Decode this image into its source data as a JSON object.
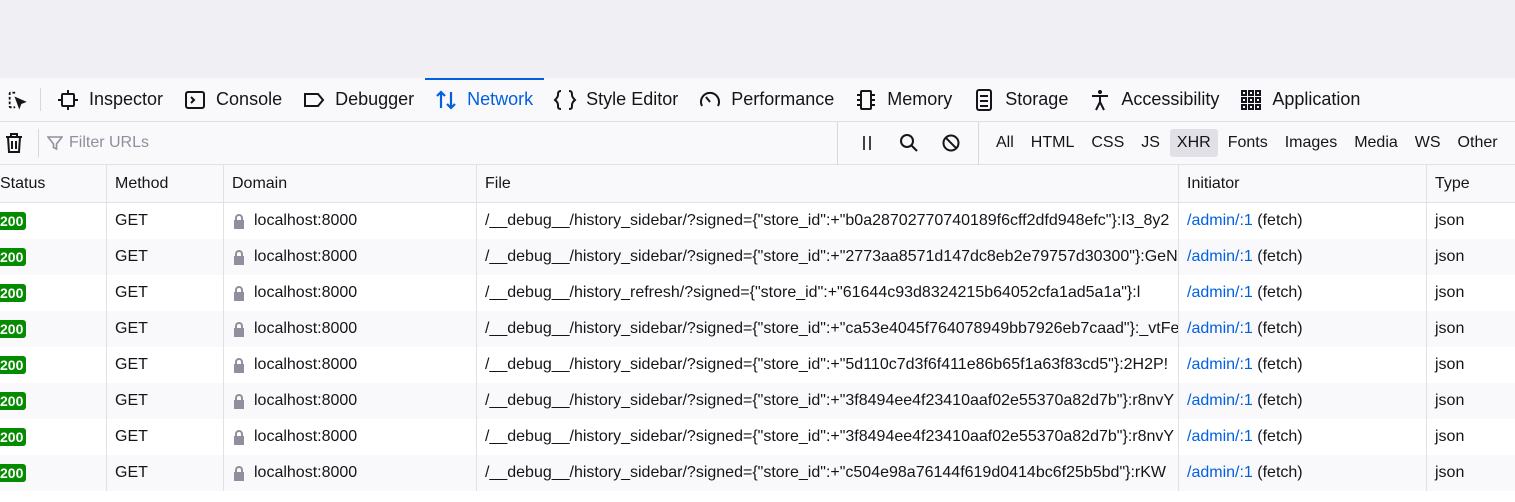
{
  "tabs": [
    {
      "label": "Inspector",
      "icon": "inspector-icon"
    },
    {
      "label": "Console",
      "icon": "console-icon"
    },
    {
      "label": "Debugger",
      "icon": "debugger-icon"
    },
    {
      "label": "Network",
      "icon": "network-icon",
      "active": true
    },
    {
      "label": "Style Editor",
      "icon": "style-editor-icon"
    },
    {
      "label": "Performance",
      "icon": "performance-icon"
    },
    {
      "label": "Memory",
      "icon": "memory-icon"
    },
    {
      "label": "Storage",
      "icon": "storage-icon"
    },
    {
      "label": "Accessibility",
      "icon": "accessibility-icon"
    },
    {
      "label": "Application",
      "icon": "application-icon"
    }
  ],
  "toolbar": {
    "filter_placeholder": "Filter URLs",
    "types": [
      "All",
      "HTML",
      "CSS",
      "JS",
      "XHR",
      "Fonts",
      "Images",
      "Media",
      "WS",
      "Other"
    ],
    "active_type": "XHR"
  },
  "columns": [
    "Status",
    "Method",
    "Domain",
    "File",
    "Initiator",
    "Type"
  ],
  "rows": [
    {
      "status": "200",
      "method": "GET",
      "domain": "localhost:8000",
      "file": "/__debug__/history_sidebar/?signed={\"store_id\":+\"b0a28702770740189f6cff2dfd948efc\"}:I3_8y2",
      "initiator": "/admin/:1",
      "initiator_suffix": "(fetch)",
      "type": "json"
    },
    {
      "status": "200",
      "method": "GET",
      "domain": "localhost:8000",
      "file": "/__debug__/history_sidebar/?signed={\"store_id\":+\"2773aa8571d147dc8eb2e79757d30300\"}:GeN",
      "initiator": "/admin/:1",
      "initiator_suffix": "(fetch)",
      "type": "json"
    },
    {
      "status": "200",
      "method": "GET",
      "domain": "localhost:8000",
      "file": "/__debug__/history_refresh/?signed={\"store_id\":+\"61644c93d8324215b64052cfa1ad5a1a\"}:l",
      "initiator": "/admin/:1",
      "initiator_suffix": "(fetch)",
      "type": "json"
    },
    {
      "status": "200",
      "method": "GET",
      "domain": "localhost:8000",
      "file": "/__debug__/history_sidebar/?signed={\"store_id\":+\"ca53e4045f764078949bb7926eb7caad\"}:_vtFe",
      "initiator": "/admin/:1",
      "initiator_suffix": "(fetch)",
      "type": "json"
    },
    {
      "status": "200",
      "method": "GET",
      "domain": "localhost:8000",
      "file": "/__debug__/history_sidebar/?signed={\"store_id\":+\"5d110c7d3f6f411e86b65f1a63f83cd5\"}:2H2P!",
      "initiator": "/admin/:1",
      "initiator_suffix": "(fetch)",
      "type": "json"
    },
    {
      "status": "200",
      "method": "GET",
      "domain": "localhost:8000",
      "file": "/__debug__/history_sidebar/?signed={\"store_id\":+\"3f8494ee4f23410aaf02e55370a82d7b\"}:r8nvY",
      "initiator": "/admin/:1",
      "initiator_suffix": "(fetch)",
      "type": "json"
    },
    {
      "status": "200",
      "method": "GET",
      "domain": "localhost:8000",
      "file": "/__debug__/history_sidebar/?signed={\"store_id\":+\"3f8494ee4f23410aaf02e55370a82d7b\"}:r8nvY",
      "initiator": "/admin/:1",
      "initiator_suffix": "(fetch)",
      "type": "json"
    },
    {
      "status": "200",
      "method": "GET",
      "domain": "localhost:8000",
      "file": "/__debug__/history_sidebar/?signed={\"store_id\":+\"c504e98a76144f619d0414bc6f25b5bd\"}:rKW",
      "initiator": "/admin/:1",
      "initiator_suffix": "(fetch)",
      "type": "json"
    }
  ]
}
